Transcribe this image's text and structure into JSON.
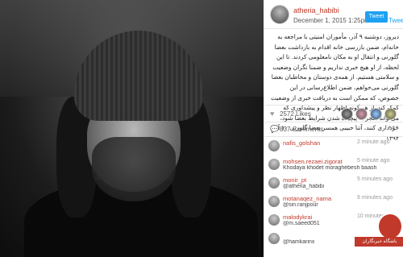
{
  "header": {
    "username": "atheria_habibi",
    "date": "December 1, 2015 1:25pm",
    "tweet_button": "Tweet",
    "tweet_link": "Tweet"
  },
  "post": {
    "caption": "دیروز، دوشنبه ۹ آذر، مأموران امنیتی با مراجعه به خانه‌ام، ضمن بازرسی خانه اقدام به بازداشت بعضا گلورنی و انتقال او به مکان نامعلومی کردند. تا این لحظه، از او هیچ خبری نداریم و ضمنا نگران وضعیت و سلامتی هستیم. از همه‌ی دوستان و مخاطبان بعضا گلورنی می‌خواهم، ضمن اطلاع‌رسانی در این خصوص، که ممکن است به دریافت خبری از وضعیت کمک کند. از هر گونه اظهار نظر و پیشداوری که می‌تواند منجر به پیچیده شدن شرایط بعضا شود، خودداری کنند، آتنا حبیبی همسر بعضا گلورنی ۱۰ آذر ۱۳۹۴",
    "likes_count": "2572 Likes",
    "comments_count": "837 Comments"
  },
  "comments": [
    {
      "user": "nafis_golshan",
      "text": "",
      "time": "2 minute ago"
    },
    {
      "user": "mohsen.rezaei.zigorat",
      "text": "Khodaya khodet moraghebesh baash",
      "time": "5 minute ago"
    },
    {
      "user": "monir_pt",
      "text": "@atheria_habibi",
      "time": "5 minutes ago"
    },
    {
      "user": "motanaqez_nama",
      "text": "@sin.ranjpour",
      "time": "9 minutes ago"
    },
    {
      "user": "malodykrai",
      "text": "@m.saeed051",
      "time": "10 minutes ago"
    },
    {
      "user": "",
      "text": "@hamkarinx",
      "time": ""
    }
  ],
  "watermark": {
    "text": "باشگاه خبرنگاران",
    "color": "#c0392b"
  },
  "icons": {
    "likes": "heart-icon",
    "comments": "comment-icon",
    "more": "more-dots-icon"
  }
}
